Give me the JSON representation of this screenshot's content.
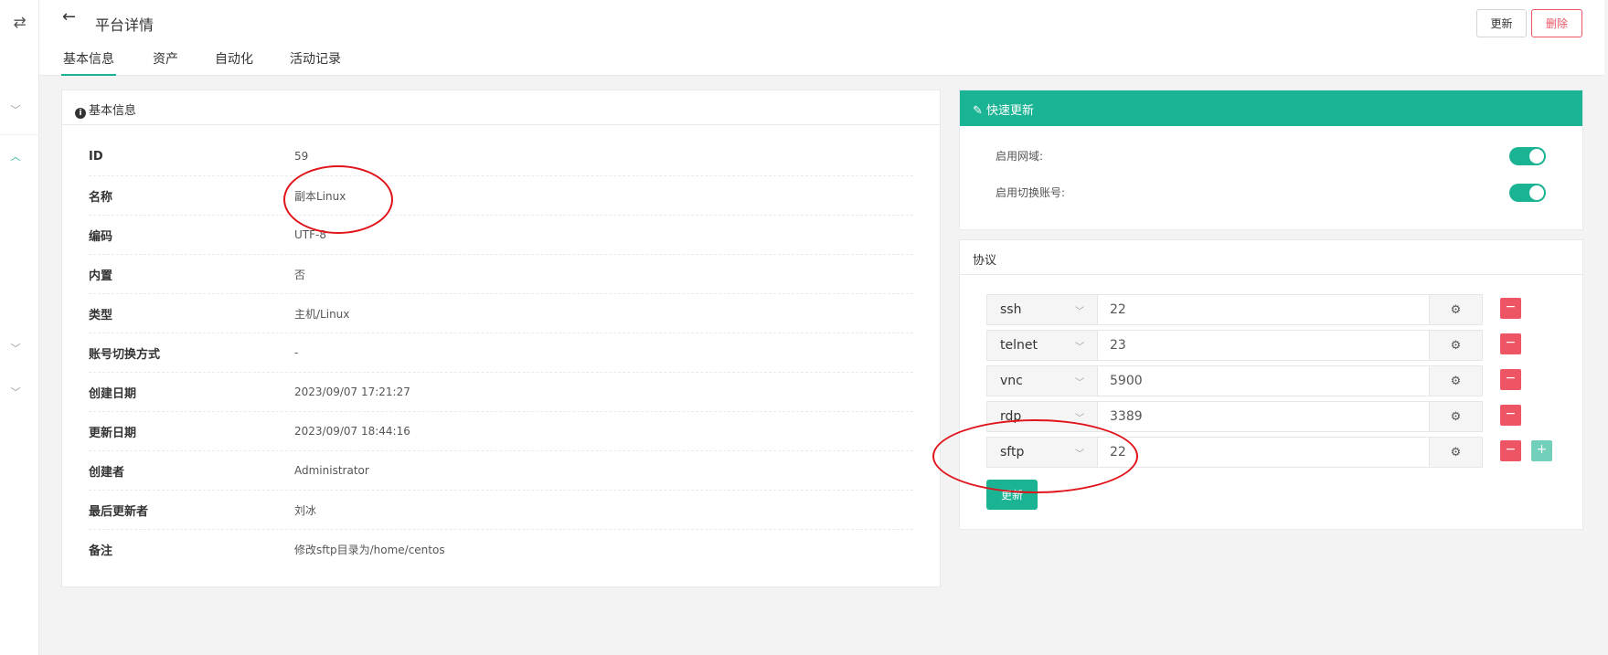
{
  "sidebar": {
    "toggle_icon": "⇄",
    "chevrons": [
      "﹀",
      "︿",
      "﹀",
      "﹀"
    ]
  },
  "header": {
    "back_icon": "←",
    "title": "平台详情",
    "tabs": [
      "基本信息",
      "资产",
      "自动化",
      "活动记录"
    ],
    "update_label": "更新",
    "delete_label": "删除"
  },
  "basic": {
    "title": "基本信息",
    "rows": [
      {
        "label": "ID",
        "value": "59"
      },
      {
        "label": "名称",
        "value": "副本Linux"
      },
      {
        "label": "编码",
        "value": "UTF-8"
      },
      {
        "label": "内置",
        "value": "否"
      },
      {
        "label": "类型",
        "value": "主机/Linux"
      },
      {
        "label": "账号切换方式",
        "value": "-"
      },
      {
        "label": "创建日期",
        "value": "2023/09/07 17:21:27"
      },
      {
        "label": "更新日期",
        "value": "2023/09/07 18:44:16"
      },
      {
        "label": "创建者",
        "value": "Administrator"
      },
      {
        "label": "最后更新者",
        "value": "刘冰"
      },
      {
        "label": "备注",
        "value": "修改sftp目录为/home/centos"
      }
    ]
  },
  "quick": {
    "title": "快速更新",
    "items": [
      {
        "label": "启用网域:",
        "enabled": true
      },
      {
        "label": "启用切换账号:",
        "enabled": true
      }
    ]
  },
  "protocols": {
    "title": "协议",
    "items": [
      {
        "name": "ssh",
        "port": "22"
      },
      {
        "name": "telnet",
        "port": "23"
      },
      {
        "name": "vnc",
        "port": "5900"
      },
      {
        "name": "rdp",
        "port": "3389"
      },
      {
        "name": "sftp",
        "port": "22"
      }
    ],
    "minus": "−",
    "plus": "+",
    "gear": "⚙",
    "update_label": "更新"
  },
  "colors": {
    "accent": "#1ab394",
    "danger": "#ed5565",
    "annotation": "#e0141a"
  }
}
